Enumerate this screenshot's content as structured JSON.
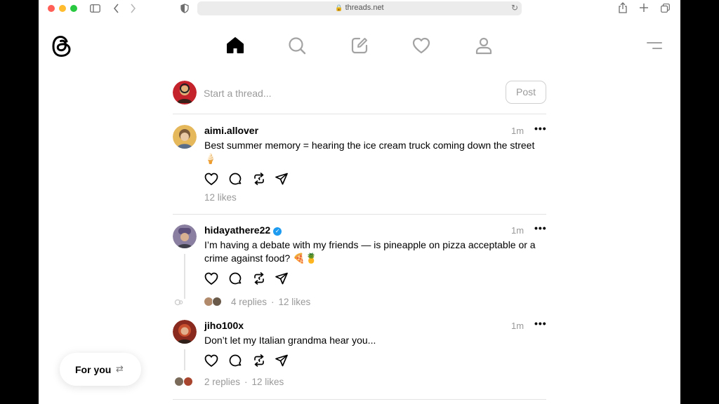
{
  "browser": {
    "url": "threads.net",
    "lock_glyph": "🔒",
    "reload_glyph": "↻"
  },
  "nav": {
    "items": [
      "home-icon",
      "search-icon",
      "compose-icon",
      "heart-icon",
      "profile-icon"
    ],
    "active": "home-icon"
  },
  "composer": {
    "placeholder": "Start a thread...",
    "post_label": "Post"
  },
  "posts": [
    {
      "username": "aimi.allover",
      "verified": false,
      "time": "1m",
      "more": "•••",
      "text": "Best summer memory = hearing the ice cream truck coming down the street 🍦",
      "likes": "12 likes"
    },
    {
      "username": "hidayathere22",
      "verified": true,
      "time": "1m",
      "more": "•••",
      "text": "I’m having a debate with my friends — is pineapple on pizza acceptable or a crime against food? 🍕🍍",
      "replies": "4 replies",
      "likes": "12 likes"
    },
    {
      "username": "jiho100x",
      "verified": false,
      "time": "1m",
      "more": "•••",
      "text": "Don’t let my Italian grandma hear you...",
      "replies": "2 replies",
      "likes": "12 likes"
    }
  ],
  "feed_toggle": {
    "label": "For you",
    "icon": "⇄"
  },
  "colors": {
    "verified": "#1d9bf0",
    "muted_text": "#999999",
    "divider": "#e3e3e3"
  }
}
